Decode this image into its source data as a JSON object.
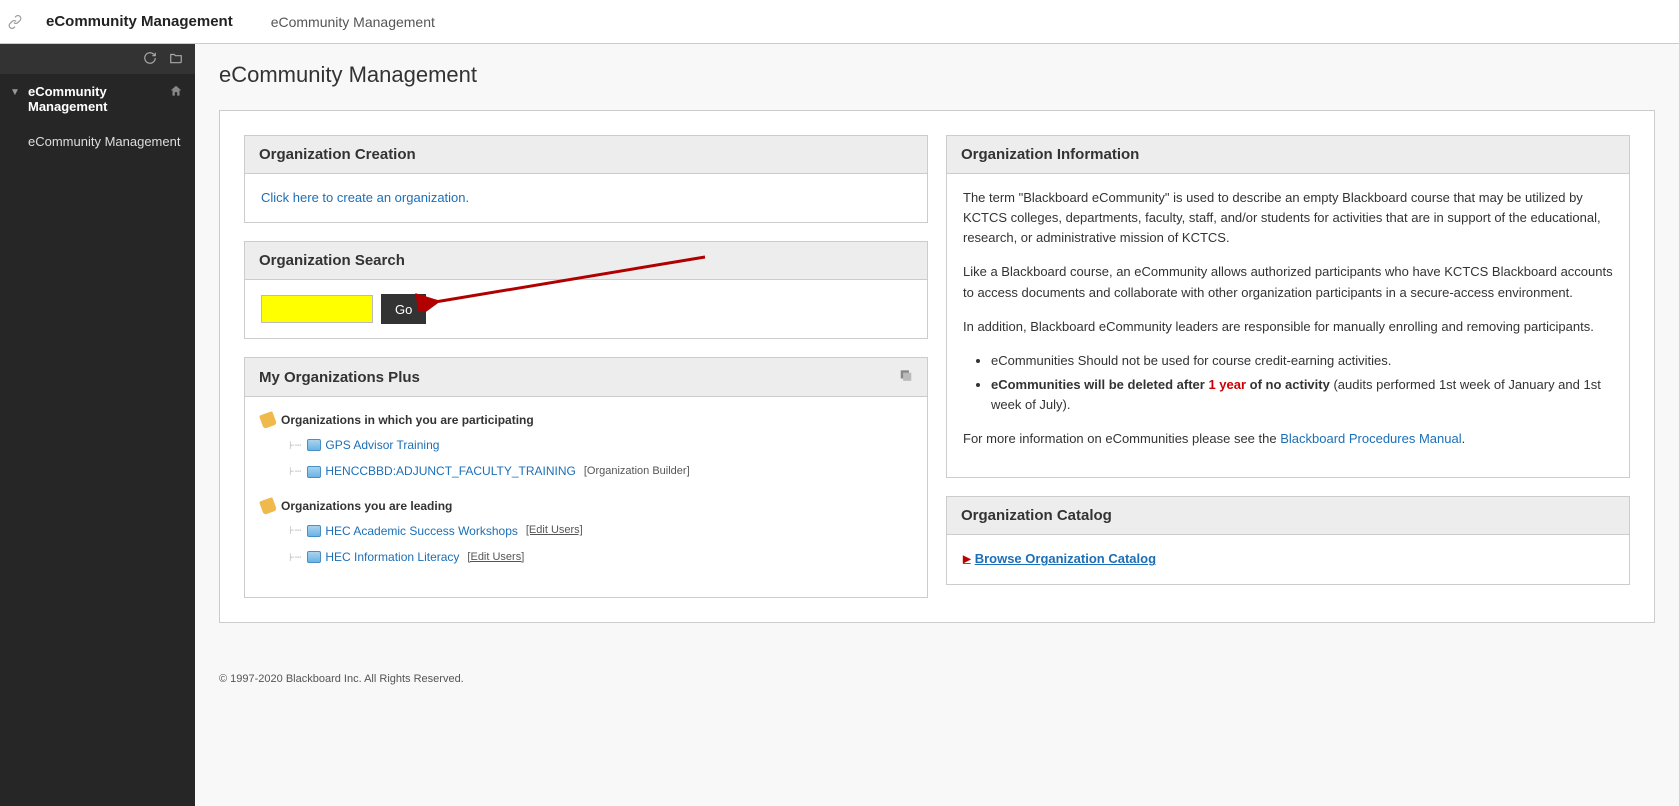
{
  "breadcrumb": {
    "main": "eCommunity Management",
    "sub": "eCommunity Management"
  },
  "sidebar": {
    "parent": "eCommunity Management",
    "child": "eCommunity Management"
  },
  "page": {
    "title": "eCommunity Management"
  },
  "panels": {
    "creation": {
      "title": "Organization Creation",
      "link": "Click here to create an organization."
    },
    "search": {
      "title": "Organization Search",
      "button": "Go",
      "value": ""
    },
    "orgs": {
      "title": "My Organizations Plus",
      "participating_label": "Organizations in which you are participating",
      "leading_label": "Organizations you are leading",
      "participating": [
        {
          "name": "GPS Advisor Training",
          "extra": ""
        },
        {
          "name": "HENCCBBD:ADJUNCT_FACULTY_TRAINING",
          "extra": "[Organization Builder]"
        }
      ],
      "leading": [
        {
          "name": "HEC Academic Success Workshops",
          "edit": "[Edit Users]"
        },
        {
          "name": "HEC Information Literacy",
          "edit": "[Edit Users]"
        }
      ]
    },
    "info": {
      "title": "Organization Information",
      "p1": "The term \"Blackboard eCommunity\" is used to describe an empty Blackboard course that may be utilized by KCTCS colleges, departments, faculty, staff, and/or students for activities that are in support of the educational, research, or administrative mission of KCTCS.",
      "p2": "Like a Blackboard course, an eCommunity allows authorized participants who have KCTCS Blackboard accounts to access documents and collaborate with other organization participants in a secure-access environment.",
      "p3": "In addition, Blackboard eCommunity leaders are responsible for manually enrolling and removing participants.",
      "li1": "eCommunities Should not be used for course credit-earning activities.",
      "li2_bold": "eCommunities will be deleted after ",
      "li2_red": "1 year",
      "li2_bold2": " of no activity",
      "li2_tail": " (audits performed 1st week of January and 1st week of July).",
      "p4_pre": "For more information on eCommunities please see the ",
      "p4_link": "Blackboard Procedures Manual",
      "p4_post": "."
    },
    "catalog": {
      "title": "Organization Catalog",
      "link": "Browse Organization Catalog"
    }
  },
  "footer": "© 1997-2020 Blackboard Inc. All Rights Reserved."
}
